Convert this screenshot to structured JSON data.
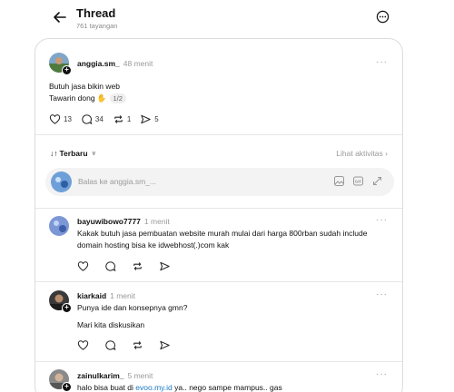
{
  "header": {
    "title": "Thread",
    "views": "761 tayangan"
  },
  "post": {
    "username": "anggia.sm_",
    "time": "48 menit",
    "line1": "Butuh jasa bikin web",
    "line2": "Tawarin dong ✋",
    "pager": "1/2",
    "likes": "13",
    "comments": "34",
    "reposts": "1",
    "shares": "5"
  },
  "sort": {
    "label": "Terbaru",
    "activity_link": "Lihat aktivitas"
  },
  "reply_box": {
    "placeholder": "Balas ke anggia.sm_..."
  },
  "replies": [
    {
      "username": "bayuwibowo7777",
      "time": "1 menit",
      "text": "Kakak butuh jasa pembuatan website murah mulai dari harga 800rban sudah include domain hosting bisa ke idwebhost(.)com kak"
    },
    {
      "username": "kiarkaid",
      "time": "1 menit",
      "text": "Punya ide dan konsepnya gmn?",
      "text2": "Mari kita diskusikan"
    },
    {
      "username": "zainulkarim_",
      "time": "5 menit",
      "text_before": "halo bisa buat di ",
      "link": "evoo.my.id",
      "text_after": " ya.. nego sampe mampus.. gas"
    }
  ],
  "icons": {
    "back": "arrow-left-icon",
    "more": "more-horizontal-circle-icon",
    "like": "heart-icon",
    "comment": "comment-bubble-icon",
    "repost": "repost-icon",
    "share": "send-icon",
    "image": "image-icon",
    "gif": "gif-icon",
    "expand": "expand-icon"
  },
  "colors": {
    "link": "#1a78c2",
    "muted": "#999999",
    "text": "#111111"
  }
}
